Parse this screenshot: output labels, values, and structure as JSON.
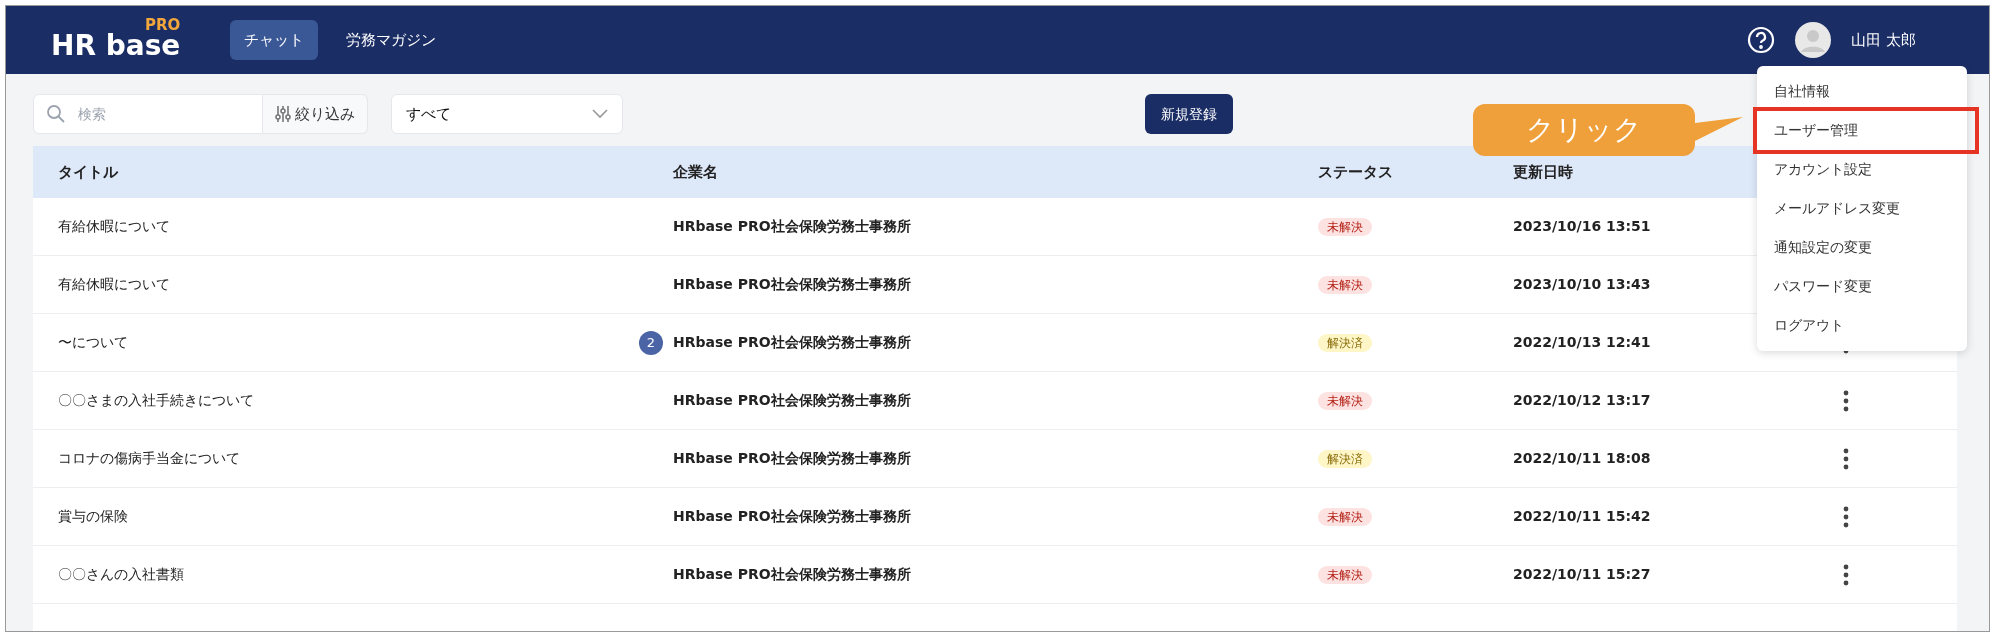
{
  "header": {
    "logo": {
      "text": "HR base",
      "badge": "PRO"
    },
    "nav": [
      {
        "label": "チャット",
        "selected": true
      },
      {
        "label": "労務マガジン",
        "selected": false
      }
    ],
    "user_name": "山田 太郎"
  },
  "toolbar": {
    "search": {
      "placeholder": "検索"
    },
    "filter_button": "絞り込み",
    "status_select": "すべて",
    "new_button": "新規登録"
  },
  "table": {
    "columns": [
      "タイトル",
      "企業名",
      "ステータス",
      "更新日時"
    ],
    "rows": [
      {
        "title": "有給休暇について",
        "company": "HRbase PRO社会保険労務士事務所",
        "status": "未解決",
        "kind": "open",
        "updated": "2023/10/16 13:51"
      },
      {
        "title": "有給休暇について",
        "company": "HRbase PRO社会保険労務士事務所",
        "status": "未解決",
        "kind": "open",
        "updated": "2023/10/10 13:43"
      },
      {
        "title": "〜について",
        "unread": "2",
        "company": "HRbase PRO社会保険労務士事務所",
        "status": "解決済",
        "kind": "resolved",
        "updated": "2022/10/13 12:41"
      },
      {
        "title": "〇〇さまの入社手続きについて",
        "company": "HRbase PRO社会保険労務士事務所",
        "status": "未解決",
        "kind": "open",
        "updated": "2022/10/12 13:17"
      },
      {
        "title": "コロナの傷病手当金について",
        "company": "HRbase PRO社会保険労務士事務所",
        "status": "解決済",
        "kind": "resolved",
        "updated": "2022/10/11 18:08"
      },
      {
        "title": "賞与の保険",
        "company": "HRbase PRO社会保険労務士事務所",
        "status": "未解決",
        "kind": "open",
        "updated": "2022/10/11 15:42"
      },
      {
        "title": "〇〇さんの入社書類",
        "company": "HRbase PRO社会保険労務士事務所",
        "status": "未解決",
        "kind": "open",
        "updated": "2022/10/11 15:27"
      }
    ]
  },
  "user_menu": [
    {
      "label": "自社情報",
      "highlighted": false
    },
    {
      "label": "ユーザー管理",
      "highlighted": true
    },
    {
      "label": "アカウント設定",
      "highlighted": false
    },
    {
      "label": "メールアドレス変更",
      "highlighted": false
    },
    {
      "label": "通知設定の変更",
      "highlighted": false
    },
    {
      "label": "パスワード変更",
      "highlighted": false
    },
    {
      "label": "ログアウト",
      "highlighted": false
    }
  ],
  "callout": {
    "text": "クリック"
  }
}
